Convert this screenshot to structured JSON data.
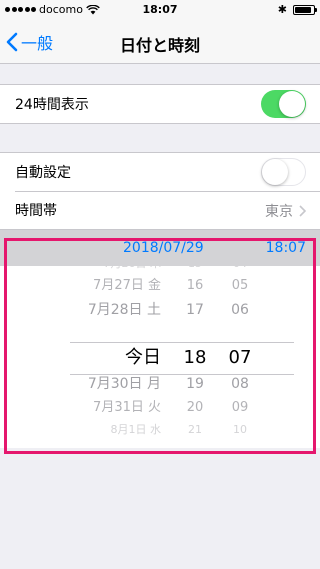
{
  "status_bar": {
    "carrier": "docomo",
    "time": "18:07"
  },
  "nav": {
    "back_label": "一般",
    "title": "日付と時刻"
  },
  "settings": {
    "hour24": {
      "label": "24時間表示",
      "on": true
    },
    "auto_set": {
      "label": "自動設定",
      "on": false
    },
    "timezone": {
      "label": "時間帯",
      "value": "東京"
    }
  },
  "date_display": {
    "date": "2018/07/29",
    "time": "18:07"
  },
  "picker": {
    "dates": [
      "7月26日 木",
      "7月27日 金",
      "7月28日 土",
      "今日",
      "7月30日 月",
      "7月31日 火",
      "8月1日 水"
    ],
    "hours": [
      "15",
      "16",
      "17",
      "18",
      "19",
      "20",
      "21"
    ],
    "minutes": [
      "04",
      "05",
      "06",
      "07",
      "08",
      "09",
      "10"
    ],
    "selected_index": 3
  },
  "colors": {
    "accent": "#007aff",
    "switch_on": "#4cd964",
    "highlight": "#e5176d"
  }
}
